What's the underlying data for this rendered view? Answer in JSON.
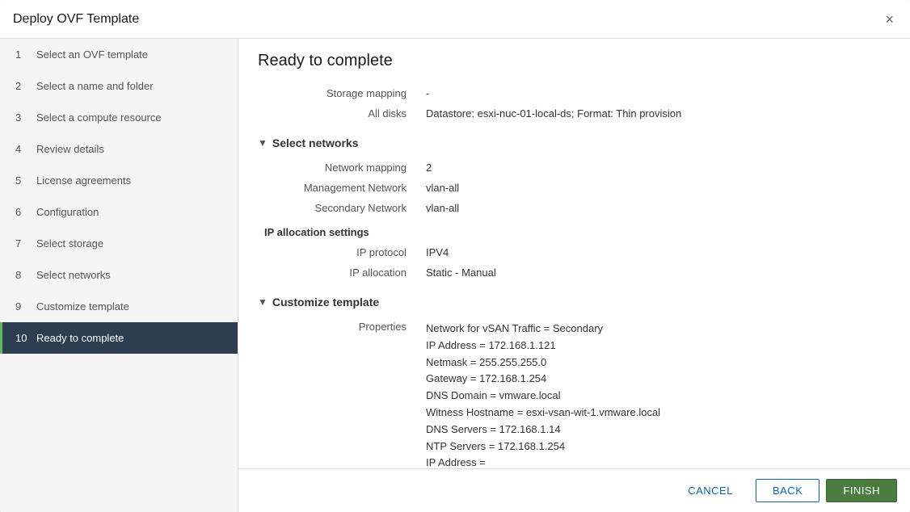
{
  "dialog": {
    "title": "Deploy OVF Template",
    "close_label": "×"
  },
  "sidebar": {
    "items": [
      {
        "num": "1",
        "label": "Select an OVF template",
        "active": false
      },
      {
        "num": "2",
        "label": "Select a name and folder",
        "active": false
      },
      {
        "num": "3",
        "label": "Select a compute resource",
        "active": false
      },
      {
        "num": "4",
        "label": "Review details",
        "active": false
      },
      {
        "num": "5",
        "label": "License agreements",
        "active": false
      },
      {
        "num": "6",
        "label": "Configuration",
        "active": false
      },
      {
        "num": "7",
        "label": "Select storage",
        "active": false
      },
      {
        "num": "8",
        "label": "Select networks",
        "active": false
      },
      {
        "num": "9",
        "label": "Customize template",
        "active": false
      },
      {
        "num": "10",
        "label": "Ready to complete",
        "active": true
      }
    ]
  },
  "main": {
    "title": "Ready to complete",
    "sections": {
      "storage_mapping_label": "Storage mapping",
      "storage_mapping_value": "-",
      "all_disks_label": "All disks",
      "all_disks_value": "Datastore: esxi-nuc-01-local-ds; Format: Thin provision",
      "select_networks_label": "Select networks",
      "network_mapping_label": "Network mapping",
      "network_mapping_value": "2",
      "management_network_label": "Management Network",
      "management_network_value": "vlan-all",
      "secondary_network_label": "Secondary Network",
      "secondary_network_value": "vlan-all",
      "ip_allocation_settings_label": "IP allocation settings",
      "ip_protocol_label": "IP protocol",
      "ip_protocol_value": "IPV4",
      "ip_allocation_label": "IP allocation",
      "ip_allocation_value": "Static - Manual",
      "customize_template_label": "Customize template",
      "properties_label": "Properties",
      "properties_value": "Network for vSAN Traffic = Secondary\nIP Address = 172.168.1.121\nNetmask = 255.255.255.0\nGateway = 172.168.1.254\nDNS Domain = vmware.local\nWitness Hostname = esxi-vsan-wit-1.vmware.local\nDNS Servers = 172.168.1.14\nNTP Servers = 172.168.1.254\nIP Address =\nNetmask =\nGateway ="
    }
  },
  "footer": {
    "cancel_label": "CANCEL",
    "back_label": "BACK",
    "finish_label": "FINISH"
  }
}
